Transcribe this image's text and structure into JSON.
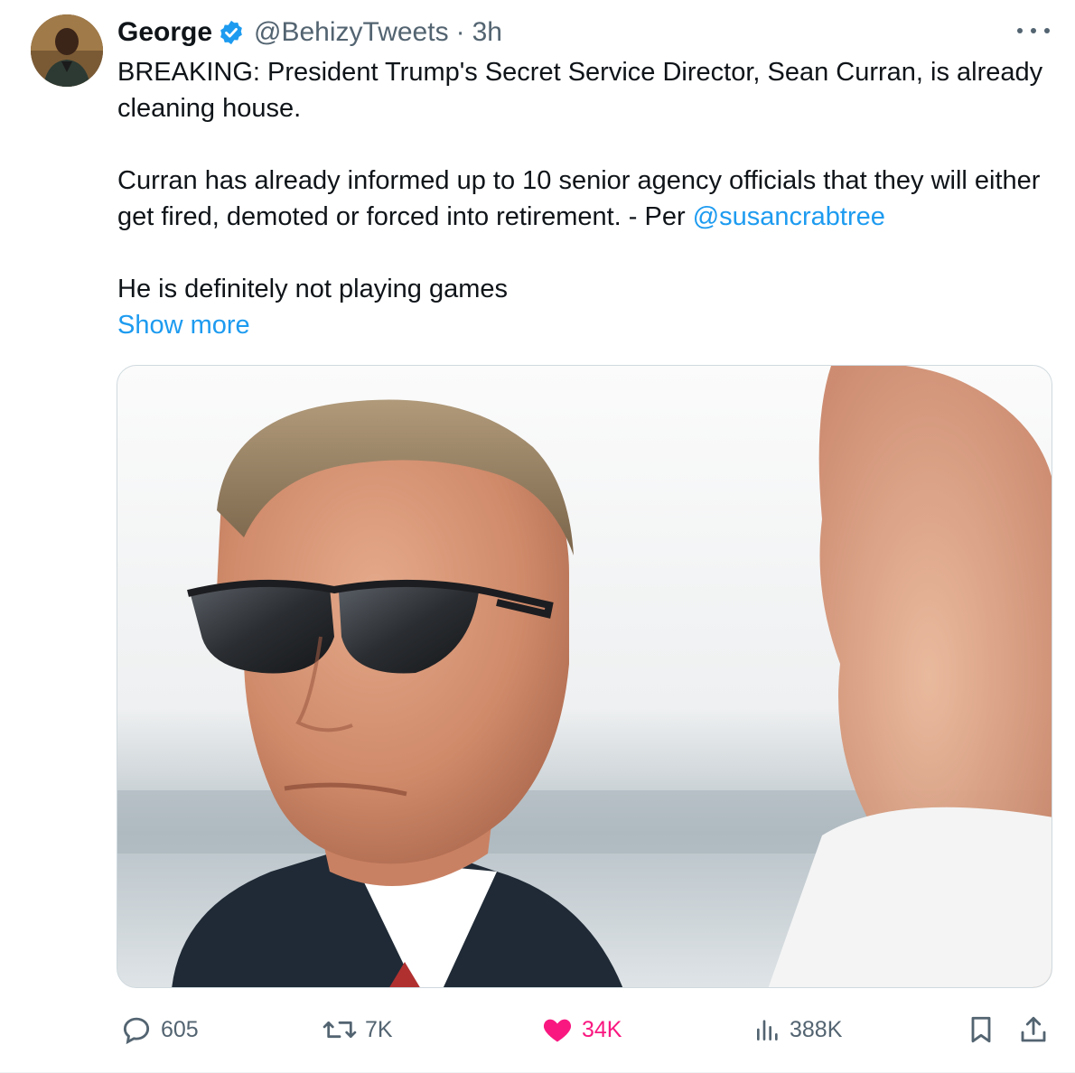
{
  "author": {
    "name": "George",
    "handle": "@BehizyTweets",
    "separator": "·",
    "time": "3h",
    "verified": true
  },
  "tweet": {
    "line1": "BREAKING: President Trump's Secret Service Director, Sean Curran, is already cleaning house.",
    "line2": "Curran has already informed up to 10 senior agency officials that they will either get fired, demoted or forced into retirement. - Per ",
    "mention": "@susancrabtree",
    "line3": "He is definitely not playing games",
    "show_more": "Show more"
  },
  "actions": {
    "replies": "605",
    "retweets": "7K",
    "likes": "34K",
    "views": "388K"
  },
  "icons": {
    "more": "more-icon",
    "verified": "verified-badge-icon",
    "reply": "reply-icon",
    "retweet": "retweet-icon",
    "like": "heart-icon",
    "views": "views-icon",
    "bookmark": "bookmark-icon",
    "share": "share-icon"
  },
  "colors": {
    "accent": "#1d9bf0",
    "like": "#f91880",
    "muted": "#536471",
    "text": "#0f1419"
  }
}
